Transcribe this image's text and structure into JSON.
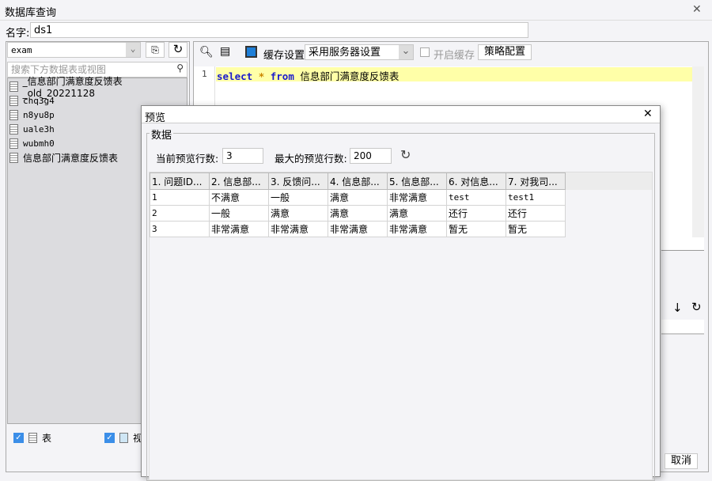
{
  "window": {
    "title": "数据库查询",
    "close": "✕"
  },
  "name_label": "名字:",
  "name_value": "ds1",
  "left": {
    "db": "exam",
    "search_placeholder": "搜索下方数据表或视图",
    "tables": [
      "_信息部门满意度反馈表_old_20221128",
      "chq3g4",
      "n8yu8p",
      "uale3h",
      "wubmh0",
      "信息部门满意度反馈表"
    ],
    "check_table": "表",
    "check_view": "视"
  },
  "toolbar": {
    "cache_label": "缓存设置",
    "cache_select": "采用服务器设置",
    "enable_cache": "开启缓存",
    "strategy": "策略配置"
  },
  "editor": {
    "line": "1",
    "kw_select": "select",
    "star": "*",
    "kw_from": "from",
    "table": "信息部门满意度反馈表"
  },
  "dialog": {
    "title": "预览",
    "group": "数据",
    "cur_rows_label": "当前预览行数:",
    "cur_rows": "3",
    "max_rows_label": "最大的预览行数:",
    "max_rows": "200",
    "columns": [
      "1. 问题ID...",
      "2. 信息部...",
      "3. 反馈问...",
      "4. 信息部...",
      "5. 信息部...",
      "6. 对信息...",
      "7. 对我司..."
    ],
    "rows": [
      [
        "1",
        "不满意",
        "一般",
        "满意",
        "非常满意",
        "test",
        "test1"
      ],
      [
        "2",
        "一般",
        "满意",
        "满意",
        "满意",
        "还行",
        "还行"
      ],
      [
        "3",
        "非常满意",
        "非常满意",
        "非常满意",
        "非常满意",
        "暂无",
        "暂无"
      ]
    ],
    "cancel": "取消"
  }
}
